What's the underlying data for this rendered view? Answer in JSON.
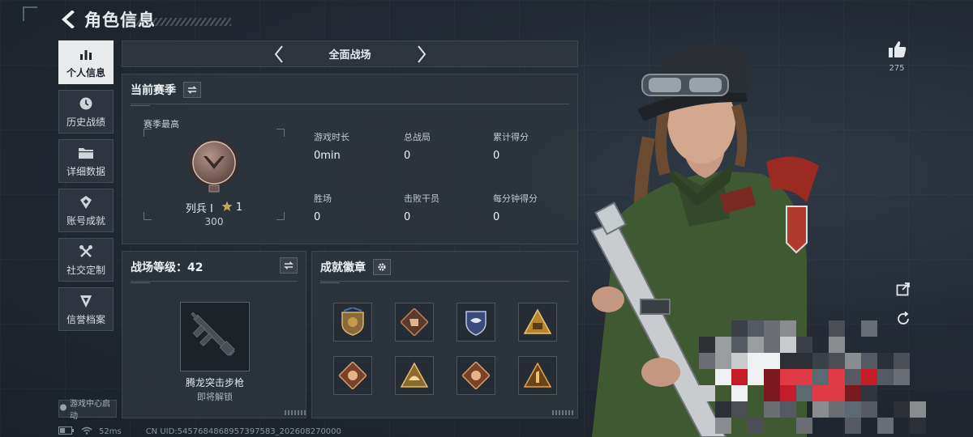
{
  "header": {
    "title": "角色信息"
  },
  "sidebar": {
    "items": [
      {
        "label": "个人信息",
        "icon": "bar-chart-icon",
        "active": true
      },
      {
        "label": "历史战绩",
        "icon": "clock-icon",
        "active": false
      },
      {
        "label": "详细数据",
        "icon": "folder-icon",
        "active": false
      },
      {
        "label": "账号成就",
        "icon": "achievement-icon",
        "active": false
      },
      {
        "label": "社交定制",
        "icon": "tools-icon",
        "active": false
      },
      {
        "label": "信誉档案",
        "icon": "credit-shield-icon",
        "active": false
      }
    ],
    "game_center_label": "游戏中心启动"
  },
  "status_bar": {
    "ping": "52ms",
    "uid": "CN UID:5457684868957397583_202608270000"
  },
  "mode_selector": {
    "title": "全面战场"
  },
  "season_panel": {
    "title": "当前赛季",
    "season_best_label": "赛季最高",
    "rank_name": "列兵 I",
    "rank_stars": "1",
    "rank_points": "300",
    "stats": [
      {
        "label": "游戏时长",
        "value": "0min"
      },
      {
        "label": "总战局",
        "value": "0"
      },
      {
        "label": "累计得分",
        "value": "0"
      },
      {
        "label": "胜场",
        "value": "0"
      },
      {
        "label": "击败干员",
        "value": "0"
      },
      {
        "label": "每分钟得分",
        "value": "0"
      }
    ]
  },
  "level_panel": {
    "title": "战场等级：42",
    "weapon_name": "腾龙突击步枪",
    "weapon_status": "即将解锁"
  },
  "badges_panel": {
    "title": "成就徽章",
    "badges": [
      "eagle-shield-badge-icon",
      "fist-badge-icon",
      "wing-shield-badge-icon",
      "triangle-soldiers-badge-icon",
      "dragon-badge-icon",
      "helmet-triangle-badge-icon",
      "dragon-badge-icon",
      "number-one-triangle-badge-icon"
    ]
  },
  "right": {
    "like_count": "275"
  },
  "colors": {
    "background": "#232a33",
    "panel": "#2d343c",
    "active_tab": "#e8eaec",
    "accent_gold": "#c9a25a"
  }
}
